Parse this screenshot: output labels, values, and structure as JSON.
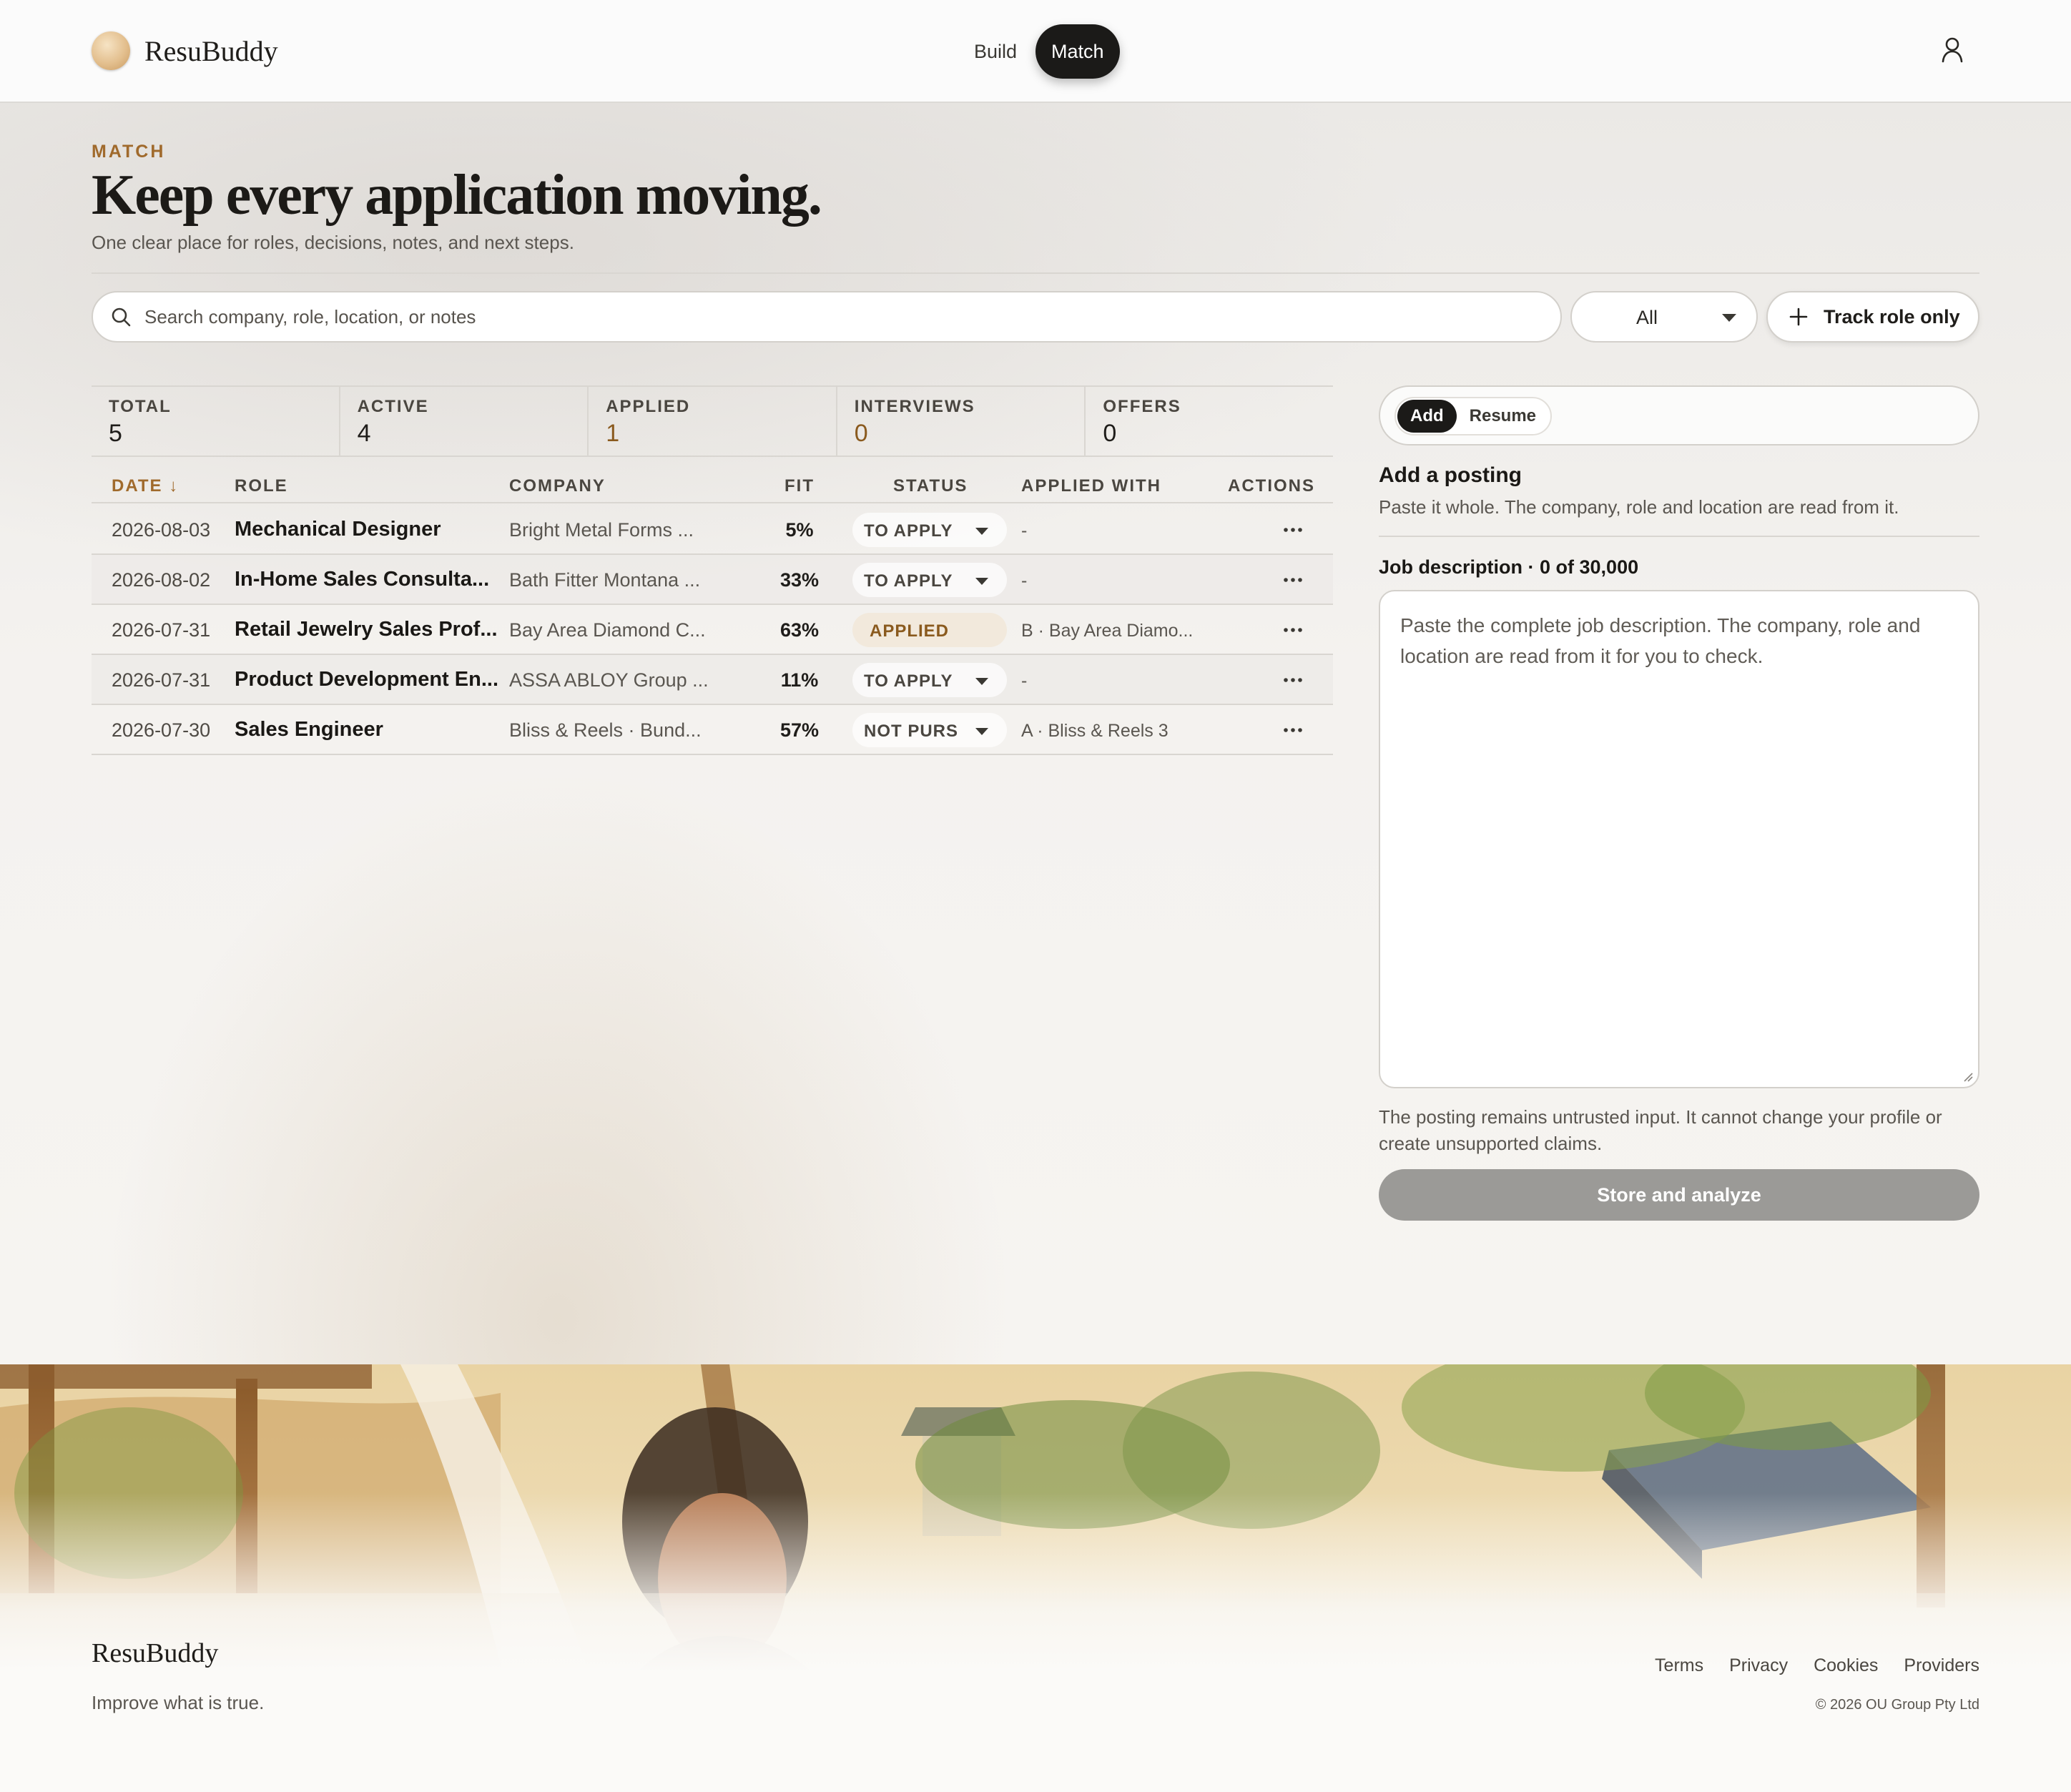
{
  "header": {
    "brand": "ResuBuddy",
    "nav": [
      {
        "label": "Build",
        "active": false
      },
      {
        "label": "Match",
        "active": true
      }
    ],
    "user_icon": "user-icon"
  },
  "page": {
    "eyebrow": "MATCH",
    "title": "Keep every application moving.",
    "subtitle": "One clear place for roles, decisions, notes, and next steps."
  },
  "toolbar": {
    "search_placeholder": "Search company, role, location, or notes",
    "search_value": "",
    "filter_value": "All",
    "track_label": "Track role only"
  },
  "stats": [
    {
      "label": "TOTAL",
      "value": "5"
    },
    {
      "label": "ACTIVE",
      "value": "4"
    },
    {
      "label": "APPLIED",
      "value": "1"
    },
    {
      "label": "INTERVIEWS",
      "value": "0"
    },
    {
      "label": "OFFERS",
      "value": "0"
    }
  ],
  "table": {
    "headers": {
      "date": "DATE",
      "role": "ROLE",
      "company": "COMPANY",
      "fit": "FIT",
      "status": "STATUS",
      "applied_with": "APPLIED WITH",
      "actions": "ACTIONS"
    },
    "sort": "descending",
    "rows": [
      {
        "date": "2026-08-03",
        "role": "Mechanical Designer",
        "company": "Bright Metal Forms ...",
        "fit": "5%",
        "status": "TO APPLY",
        "applied_with": "-"
      },
      {
        "date": "2026-08-02",
        "role": "In-Home Sales Consulta...",
        "company": "Bath Fitter Montana ...",
        "fit": "33%",
        "status": "TO APPLY",
        "applied_with": "-"
      },
      {
        "date": "2026-07-31",
        "role": "Retail Jewelry Sales Prof...",
        "company": "Bay Area Diamond C...",
        "fit": "63%",
        "status": "APPLIED",
        "applied_with": "B · Bay Area Diamo..."
      },
      {
        "date": "2026-07-31",
        "role": "Product Development En...",
        "company": "ASSA ABLOY Group ...",
        "fit": "11%",
        "status": "TO APPLY",
        "applied_with": "-"
      },
      {
        "date": "2026-07-30",
        "role": "Sales Engineer",
        "company": "Bliss & Reels · Bund...",
        "fit": "57%",
        "status": "NOT PURS",
        "applied_with": "A · Bliss & Reels 3"
      }
    ]
  },
  "panel": {
    "tabs": [
      {
        "label": "Add",
        "active": true
      },
      {
        "label": "Resume",
        "active": false
      }
    ],
    "title": "Add a posting",
    "subtitle": "Paste it whole. The company, role and location are read from it.",
    "jd_label": "Job description · 0 of 30,000",
    "jd_placeholder": "Paste the complete job description. The company, role and location are read from it for you to check.",
    "jd_value": "",
    "note": "The posting remains untrusted input. It cannot change your profile or create unsupported claims.",
    "submit_label": "Store and analyze"
  },
  "footer": {
    "brand": "ResuBuddy",
    "tagline": "Improve what is true.",
    "links": [
      "Terms",
      "Privacy",
      "Cookies",
      "Providers"
    ],
    "copyright": "© 2026 OU Group Pty Ltd"
  },
  "colors": {
    "accent": "#a06a2c",
    "dark": "#1b1a18",
    "border": "#d3d0cb",
    "disabled_button": "#9b9a97"
  }
}
